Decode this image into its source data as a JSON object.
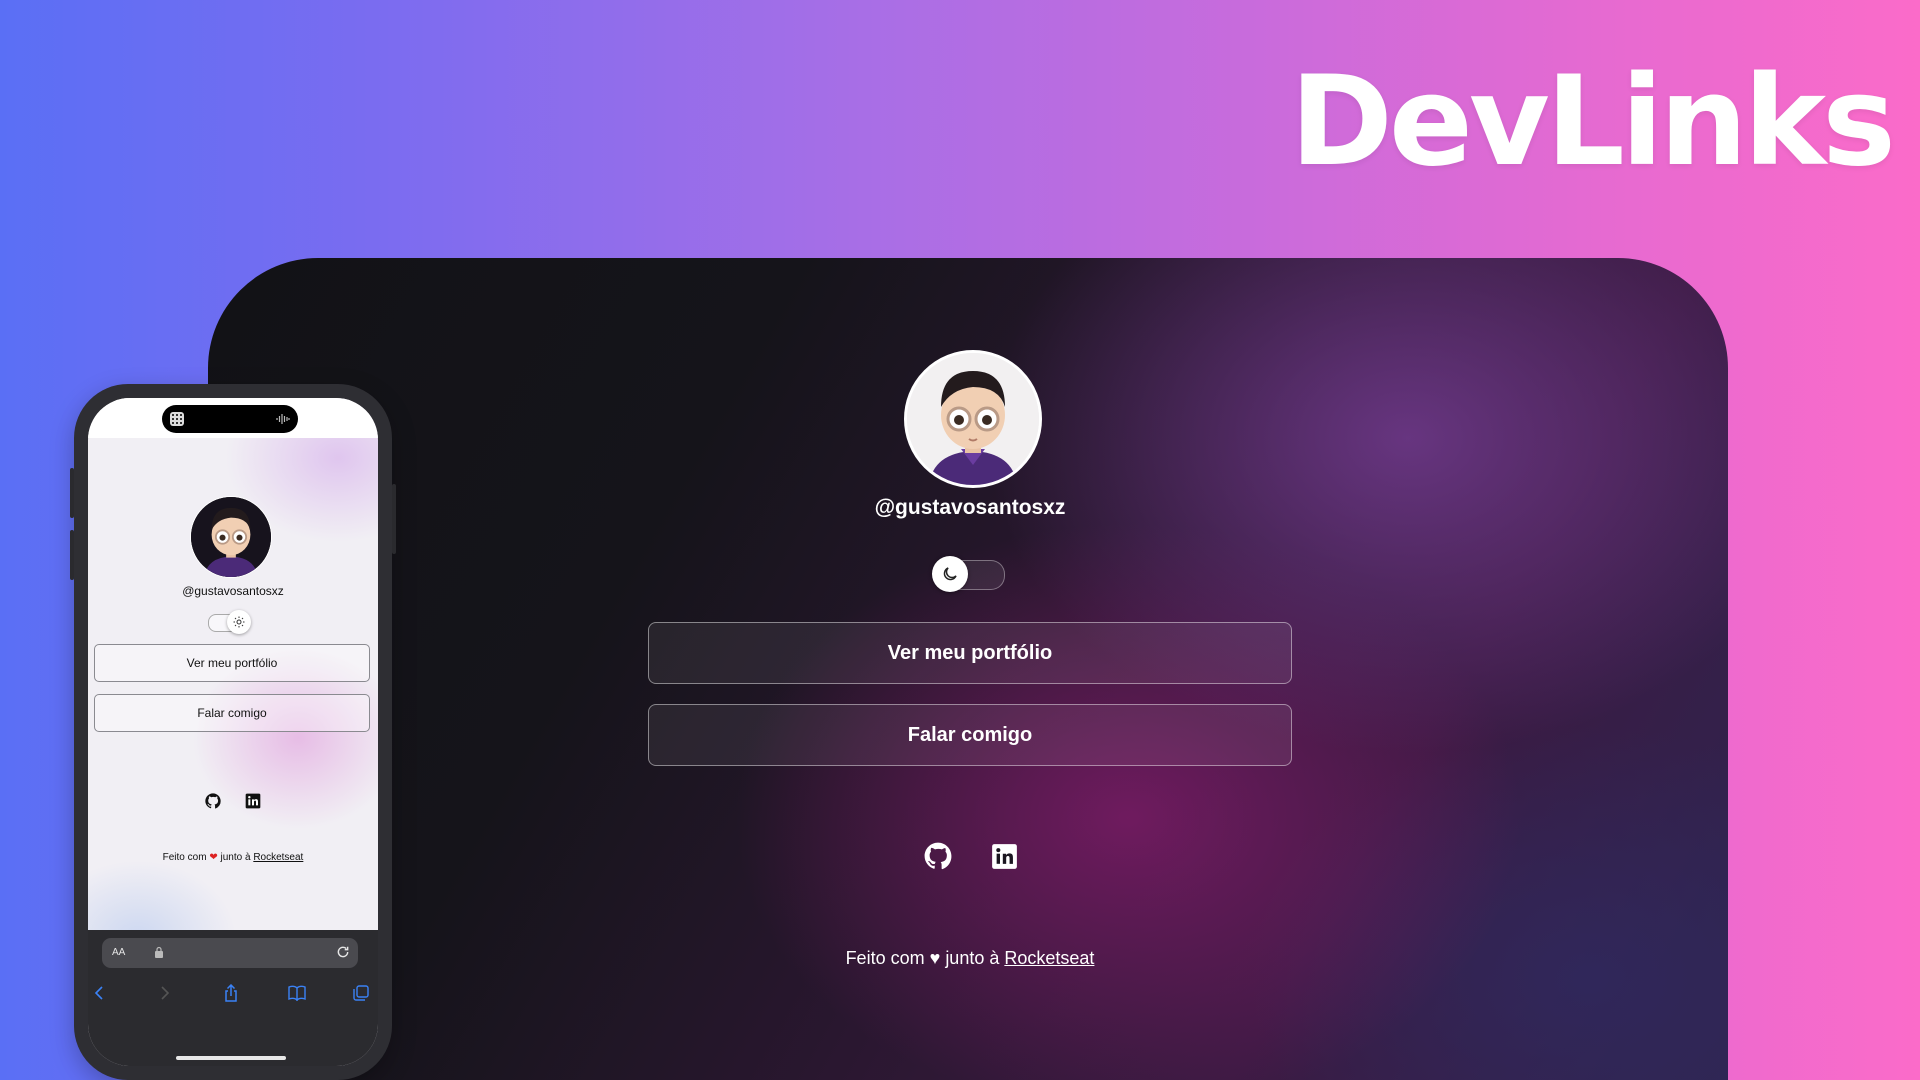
{
  "brand": {
    "title": "DevLinks"
  },
  "desktop": {
    "username": "@gustavosantosxz",
    "theme_toggle": {
      "state": "dark",
      "icon": "moon-icon"
    },
    "links": [
      {
        "label": "Ver meu portfólio"
      },
      {
        "label": "Falar comigo"
      }
    ],
    "social": [
      {
        "icon": "github-icon"
      },
      {
        "icon": "linkedin-icon"
      }
    ],
    "footer": {
      "prefix": "Feito com",
      "heart": "♥",
      "middle": "junto à",
      "link": "Rocketseat"
    }
  },
  "phone": {
    "username": "@gustavosantosxz",
    "theme_toggle": {
      "state": "light",
      "icon": "sun-icon"
    },
    "links": [
      {
        "label": "Ver meu portfólio"
      },
      {
        "label": "Falar comigo"
      }
    ],
    "social": [
      {
        "icon": "github-icon"
      },
      {
        "icon": "linkedin-icon"
      }
    ],
    "footer": {
      "prefix": "Feito com",
      "heart": "❤",
      "middle": "junto à",
      "link": "Rocketseat"
    },
    "browser": {
      "text_size_label": "AA"
    }
  },
  "colors": {
    "bg_gradient_left": "#5a6ff5",
    "bg_gradient_right": "#fb6bc9",
    "desktop_bg": "#15141a",
    "accent_purple": "#703a8c",
    "safari_toolbar": "#2b2b2f",
    "safari_icon_blue": "#3b82f6"
  }
}
